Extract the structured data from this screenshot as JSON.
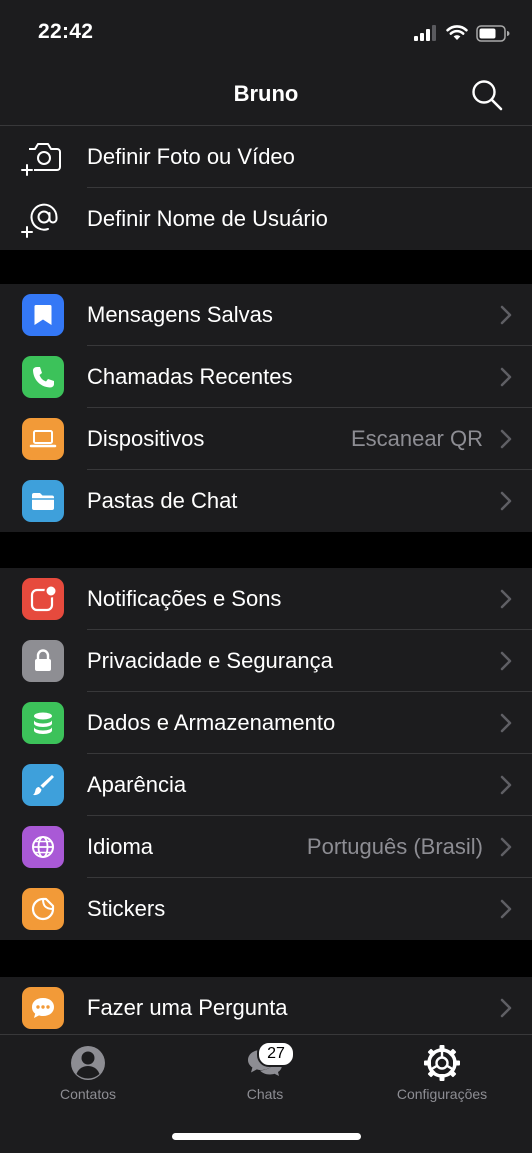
{
  "status_bar": {
    "time": "22:42"
  },
  "header": {
    "title": "Bruno"
  },
  "profile_actions": [
    {
      "label": "Definir Foto ou Vídeo",
      "icon": "camera-add-icon"
    },
    {
      "label": "Definir Nome de Usuário",
      "icon": "at-add-icon"
    }
  ],
  "group1": [
    {
      "label": "Mensagens Salvas",
      "icon": "bookmark-icon",
      "color": "#3478f6"
    },
    {
      "label": "Chamadas Recentes",
      "icon": "phone-icon",
      "color": "#3cc25a"
    },
    {
      "label": "Dispositivos",
      "value": "Escanear QR",
      "icon": "laptop-icon",
      "color": "#f29a38"
    },
    {
      "label": "Pastas de Chat",
      "icon": "folder-icon",
      "color": "#3ea0db"
    }
  ],
  "group2": [
    {
      "label": "Notificações e Sons",
      "icon": "notification-badge-icon",
      "color": "#e64a3d"
    },
    {
      "label": "Privacidade e Segurança",
      "icon": "lock-icon",
      "color": "#8e8e93"
    },
    {
      "label": "Dados e Armazenamento",
      "icon": "database-icon",
      "color": "#3cc25a"
    },
    {
      "label": "Aparência",
      "icon": "brush-icon",
      "color": "#3ea0db"
    },
    {
      "label": "Idioma",
      "value": "Português (Brasil)",
      "icon": "globe-icon",
      "color": "#a959d6"
    },
    {
      "label": "Stickers",
      "icon": "sticker-icon",
      "color": "#f29a38"
    }
  ],
  "group3": [
    {
      "label": "Fazer uma Pergunta",
      "icon": "chat-bubble-icon",
      "color": "#f29a38"
    }
  ],
  "tabs": [
    {
      "label": "Contatos",
      "icon": "person-circle-icon",
      "active": false
    },
    {
      "label": "Chats",
      "icon": "chats-bubbles-icon",
      "badge": "27",
      "active": false
    },
    {
      "label": "Configurações",
      "icon": "settings-gear-icon",
      "active": true
    }
  ],
  "colors": {
    "background": "#000000",
    "surface": "#1c1c1e",
    "separator": "#38383a",
    "secondary_text": "#8d8d93"
  }
}
